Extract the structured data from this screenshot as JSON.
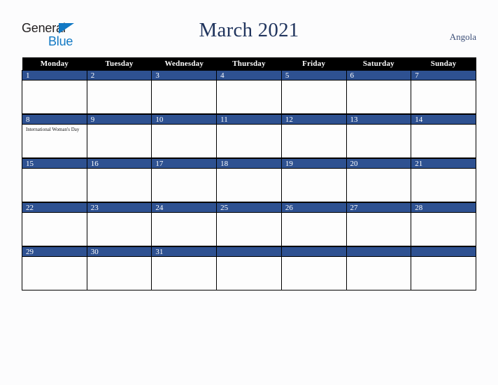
{
  "brand": {
    "name_part1": "General",
    "name_part2": "Blue",
    "triangle_color": "#1279c4",
    "text_color": "#231f20"
  },
  "header": {
    "title": "March 2021",
    "country": "Angola",
    "title_color": "#21355e"
  },
  "calendar": {
    "day_headers": [
      "Monday",
      "Tuesday",
      "Wednesday",
      "Thursday",
      "Friday",
      "Saturday",
      "Sunday"
    ],
    "header_bg": "#000000",
    "daybar_bg": "#2e5191",
    "daybar_text": "#ffffff",
    "weeks": [
      [
        {
          "day": "1",
          "event": ""
        },
        {
          "day": "2",
          "event": ""
        },
        {
          "day": "3",
          "event": ""
        },
        {
          "day": "4",
          "event": ""
        },
        {
          "day": "5",
          "event": ""
        },
        {
          "day": "6",
          "event": ""
        },
        {
          "day": "7",
          "event": ""
        }
      ],
      [
        {
          "day": "8",
          "event": "International Woman's Day"
        },
        {
          "day": "9",
          "event": ""
        },
        {
          "day": "10",
          "event": ""
        },
        {
          "day": "11",
          "event": ""
        },
        {
          "day": "12",
          "event": ""
        },
        {
          "day": "13",
          "event": ""
        },
        {
          "day": "14",
          "event": ""
        }
      ],
      [
        {
          "day": "15",
          "event": ""
        },
        {
          "day": "16",
          "event": ""
        },
        {
          "day": "17",
          "event": ""
        },
        {
          "day": "18",
          "event": ""
        },
        {
          "day": "19",
          "event": ""
        },
        {
          "day": "20",
          "event": ""
        },
        {
          "day": "21",
          "event": ""
        }
      ],
      [
        {
          "day": "22",
          "event": ""
        },
        {
          "day": "23",
          "event": ""
        },
        {
          "day": "24",
          "event": ""
        },
        {
          "day": "25",
          "event": ""
        },
        {
          "day": "26",
          "event": ""
        },
        {
          "day": "27",
          "event": ""
        },
        {
          "day": "28",
          "event": ""
        }
      ],
      [
        {
          "day": "29",
          "event": ""
        },
        {
          "day": "30",
          "event": ""
        },
        {
          "day": "31",
          "event": ""
        },
        {
          "day": "",
          "event": ""
        },
        {
          "day": "",
          "event": ""
        },
        {
          "day": "",
          "event": ""
        },
        {
          "day": "",
          "event": ""
        }
      ]
    ]
  }
}
